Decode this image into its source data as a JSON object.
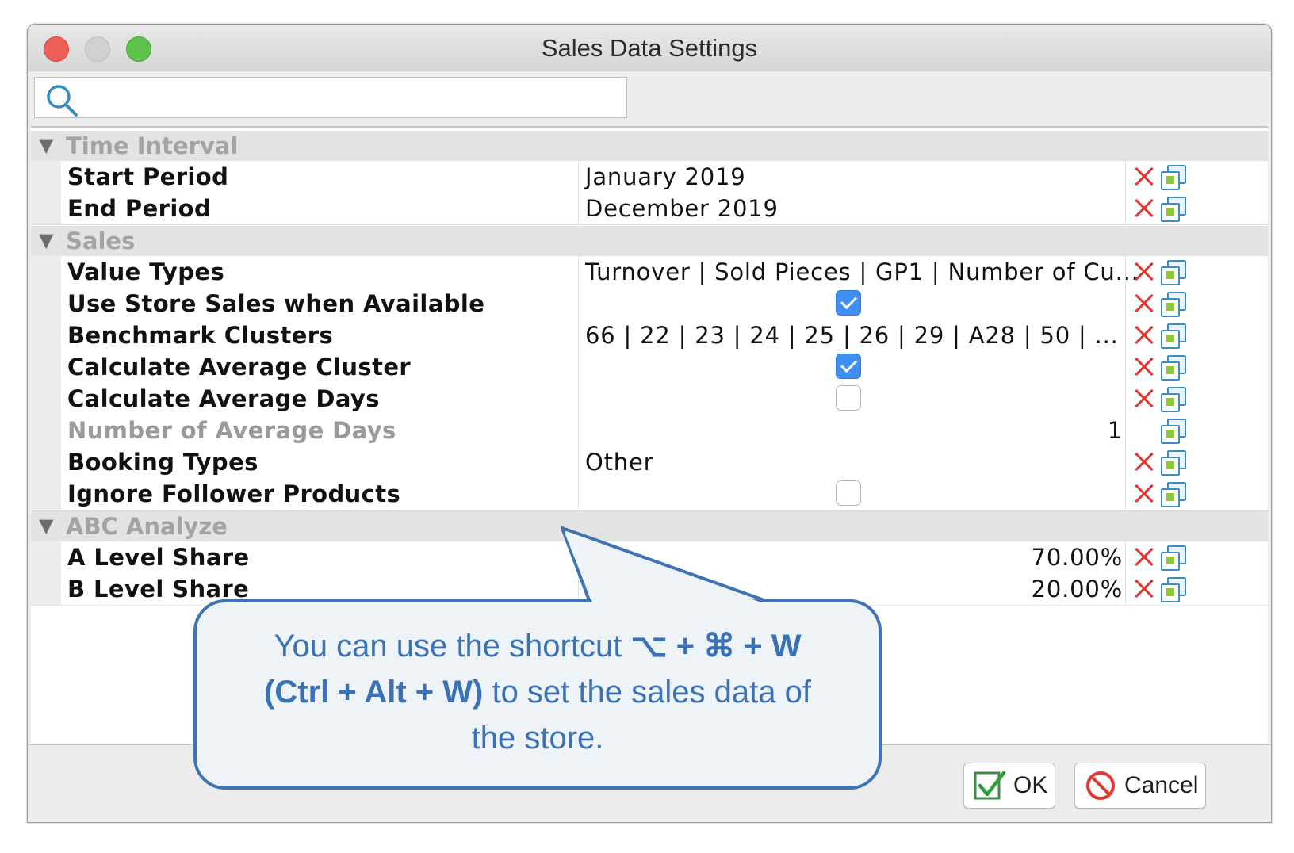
{
  "window": {
    "title": "Sales Data Settings"
  },
  "search": {
    "placeholder": "",
    "value": ""
  },
  "groups": [
    {
      "label": "Time Interval",
      "rows": [
        {
          "name": "Start Period",
          "value": "January 2019",
          "type": "text"
        },
        {
          "name": "End Period",
          "value": "December 2019",
          "type": "text"
        }
      ]
    },
    {
      "label": "Sales",
      "rows": [
        {
          "name": "Value Types",
          "value": "Turnover | Sold Pieces | GP1 | Number of Cu...",
          "type": "text"
        },
        {
          "name": "Use Store Sales when Available",
          "checked": true,
          "type": "checkbox"
        },
        {
          "name": "Benchmark Clusters",
          "value": "66 | 22 | 23 | 24 | 25 | 26 | 29 | A28 | 50 | ...",
          "type": "text"
        },
        {
          "name": "Calculate Average Cluster",
          "checked": true,
          "type": "checkbox"
        },
        {
          "name": "Calculate Average Days",
          "checked": false,
          "type": "checkbox"
        },
        {
          "name": "Number of Average Days",
          "value": "1",
          "type": "number",
          "disabled": true
        },
        {
          "name": "Booking Types",
          "value": "Other",
          "type": "text"
        },
        {
          "name": "Ignore Follower Products",
          "checked": false,
          "type": "checkbox"
        }
      ]
    },
    {
      "label": "ABC Analyze",
      "rows": [
        {
          "name": "A Level Share",
          "value": "70.00%",
          "type": "percent"
        },
        {
          "name": "B Level Share",
          "value": "20.00%",
          "type": "percent"
        }
      ]
    }
  ],
  "footer": {
    "ok_label": "OK",
    "cancel_label": "Cancel"
  },
  "callout": {
    "line1_pre": "You can use the shortcut ",
    "line1_keys": "⌥ + ⌘ + W",
    "line2_keys": "(Ctrl + Alt + W)",
    "line2_post": " to set the sales data of",
    "line3": "the store."
  },
  "icons": {
    "search": "search-icon",
    "clear": "clear-x-icon",
    "copy": "copy-value-icon",
    "ok": "checkmark-icon",
    "cancel": "prohibited-icon"
  },
  "colors": {
    "accent": "#3d8ff4",
    "clear_x": "#e53230",
    "callout_border": "#3f74b3",
    "callout_text": "#3a72b5",
    "callout_fill": "#eef3f8"
  }
}
